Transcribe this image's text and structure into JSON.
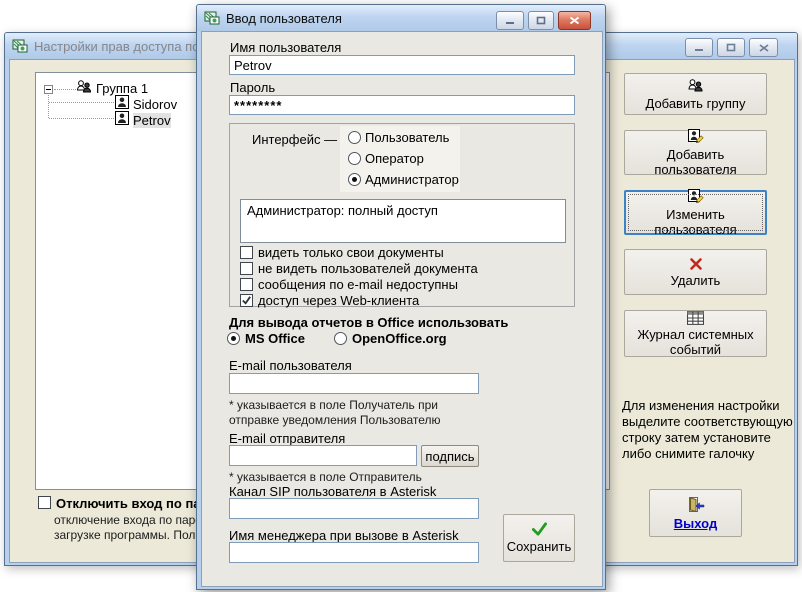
{
  "dialog": {
    "title": "Ввод пользователя",
    "username_label": "Имя пользователя",
    "username_value": "Petrov",
    "password_label": "Пароль",
    "password_value": "********",
    "interface": {
      "label": "Интерфейс —",
      "options": [
        {
          "label": "Пользователь",
          "selected": false
        },
        {
          "label": "Оператор",
          "selected": false
        },
        {
          "label": "Администратор",
          "selected": true
        }
      ],
      "description": "Администратор: полный доступ"
    },
    "checkboxes": [
      {
        "label": "видеть только свои документы",
        "checked": false
      },
      {
        "label": "не видеть пользователей документа",
        "checked": false
      },
      {
        "label": "сообщения по e-mail недоступны",
        "checked": false
      },
      {
        "label": "доступ через Web-клиента",
        "checked": true
      }
    ],
    "office_label": "Для вывода отчетов в Office использовать",
    "office_options": [
      {
        "label": "MS Office",
        "selected": true
      },
      {
        "label": "OpenOffice.org",
        "selected": false
      }
    ],
    "email_user_label": "E-mail пользователя",
    "email_user_value": "",
    "email_user_note1": "* указывается в поле Получатель при",
    "email_user_note2": "отправке уведомления Пользователю",
    "email_sender_label": "E-mail отправителя",
    "email_sender_value": "",
    "signature_button": "подпись",
    "email_sender_note": "* указывается в поле Отправитель",
    "sip_label": "Канал SIP пользователя в Asterisk",
    "sip_value": "",
    "manager_label": "Имя менеджера при вызове в Asterisk",
    "manager_value": "",
    "save_button": "Сохранить"
  },
  "main_window": {
    "title": "Настройки прав доступа поль",
    "tree": {
      "group_label": "Группа 1",
      "users": [
        {
          "label": "Sidorov"
        },
        {
          "label": "Petrov"
        }
      ]
    },
    "disable_login_checkbox": {
      "label": "Отключить вход по паро",
      "desc_line1": "отключение входа по парол",
      "desc_line2": "загрузке программы. Полнь",
      "checked": false
    },
    "buttons": [
      {
        "label": "Добавить группу",
        "icon": "add-group-icon"
      },
      {
        "label": "Добавить пользователя",
        "icon": "add-user-icon"
      },
      {
        "label": "Изменить пользователя",
        "icon": "edit-user-icon"
      },
      {
        "label": "Удалить",
        "icon": "delete-icon"
      },
      {
        "label": "Журнал системных событий",
        "icon": "journal-icon"
      }
    ],
    "help_lines": [
      "Для изменения настройки",
      "выделите соответствующую",
      "строку затем установите",
      "либо снимите галочку"
    ],
    "exit_button": "Выход"
  },
  "colors": {
    "accent_blue": "#3b82c8",
    "delete_red": "#c2291c",
    "save_green": "#1f9e1f",
    "link_blue": "#0000cc",
    "main_client_bg": "#ece9d8",
    "dialog_client_bg": "#e9e8e3"
  }
}
